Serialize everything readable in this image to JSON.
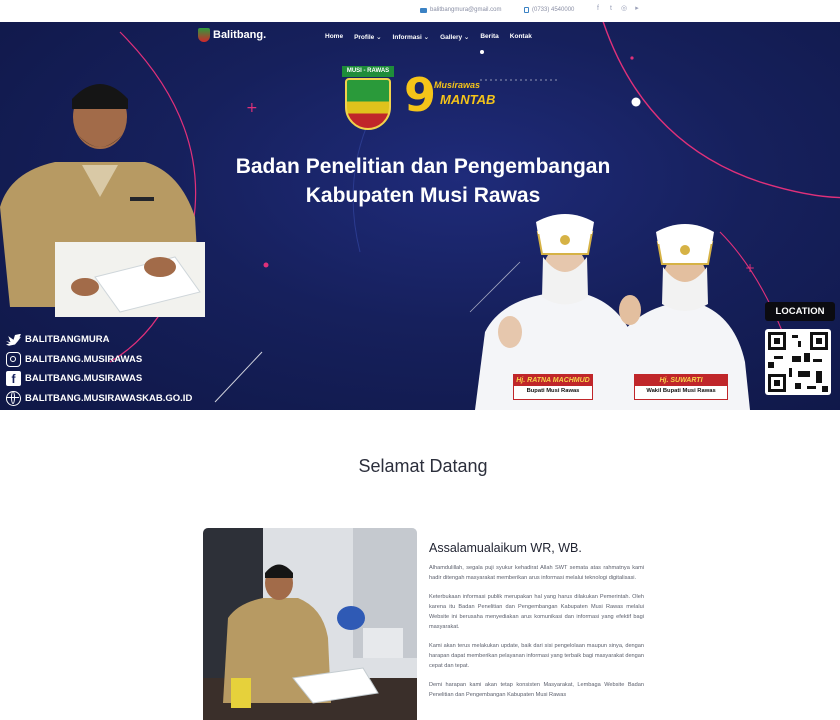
{
  "topbar": {
    "email": "balitbangmura@gmail.com",
    "phone": "(0733) 4540000",
    "social_icons": [
      "facebook-icon",
      "twitter-icon",
      "instagram-icon",
      "youtube-icon"
    ]
  },
  "nav": {
    "brand": "Balitbang.",
    "items": [
      {
        "label": "Home"
      },
      {
        "label": "Profile ⌄"
      },
      {
        "label": "Informasi ⌄"
      },
      {
        "label": "Gallery ⌄"
      },
      {
        "label": "Berita"
      },
      {
        "label": "Kontak"
      }
    ]
  },
  "hero": {
    "crest_banner": "MUSI - RAWAS",
    "mantab_top": "Musirawas",
    "mantab_bottom": "MANTAB",
    "title_line1": "Badan Penelitian dan Pengembangan",
    "title_line2": "Kabupaten Musi Rawas",
    "socials": [
      {
        "icon": "twitter-icon",
        "label": "BALITBANGMURA"
      },
      {
        "icon": "instagram-icon",
        "label": "BALITBANG.MUSIRAWAS"
      },
      {
        "icon": "facebook-icon",
        "label": "BALITBANG.MUSIRAWAS"
      },
      {
        "icon": "globe-icon",
        "label": "BALITBANG.MUSIRAWASKAB.GO.ID"
      }
    ],
    "location_label": "LOCATION",
    "officials": [
      {
        "name": "Hj. RATNA MACHMUD",
        "role": "Bupati Musi Rawas"
      },
      {
        "name": "Hj. SUWARTI",
        "role": "Wakil Bupati Musi Rawas"
      }
    ],
    "colors": {
      "accent_pink": "#e0307a",
      "navy": "#16205c"
    }
  },
  "welcome": {
    "title": "Selamat Datang",
    "heading": "Assalamualaikum WR, WB.",
    "paragraphs": [
      "Alhamdulillah, segala puji syukur kehadirat Allah SWT semata atas rahmatnya kami hadir ditengah masyarakat memberikan arus informasi melalui teknologi digitalisasi.",
      "Keterbukaan informasi publik merupakan hal yang harus dilakukan Pemerintah. Oleh karena itu Badan Penelitian dan Pengembangan Kabupaten Musi Rawas melalui Website ini berusaha menyediakan arus komunikasi dan informasi yang efektif bagi masyarakat.",
      "Kami akan terus melakukan update, baik dari sisi pengelolaan maupun sinya, dengan harapan dapat memberikan pelayanan informasi yang terbaik bagi masyarakat dengan cepat dan tepat.",
      "Demi harapan kami akan tetap konsisten Masyarakat, Lembaga Website Badan Penelitian dan Pengembangan Kabupaten Musi Rawas"
    ]
  }
}
